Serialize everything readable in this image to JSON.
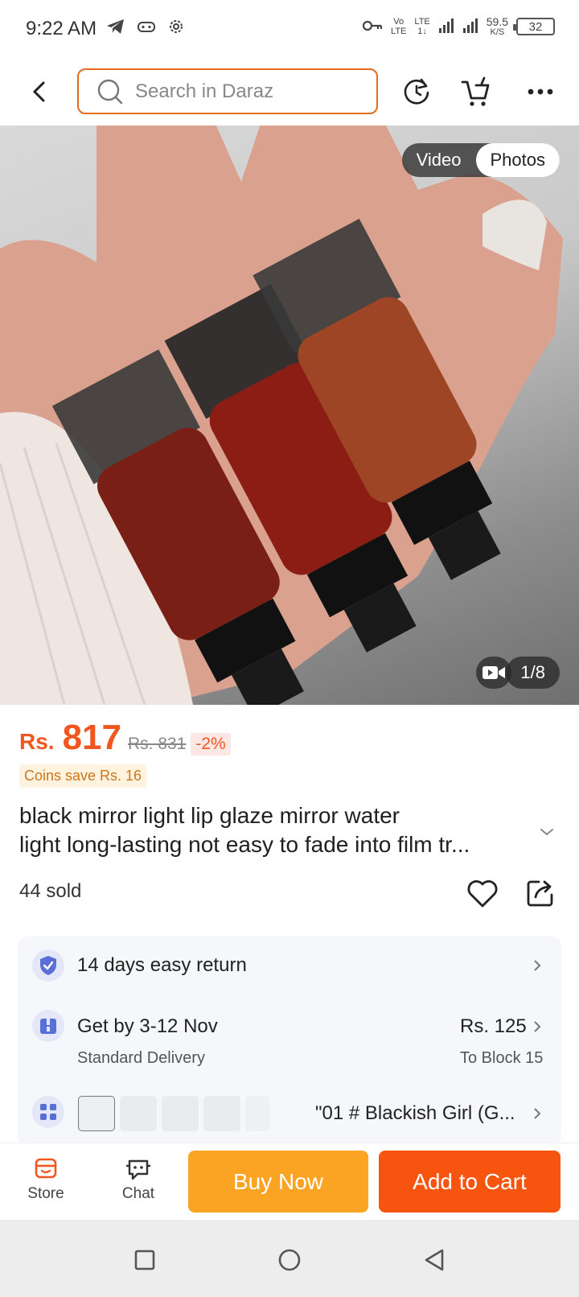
{
  "status_bar": {
    "time": "9:22 AM",
    "lte_top": "Vo",
    "lte_bottom": "LTE",
    "lte2_top": "LTE",
    "lte2_bottom": "1↓",
    "net_speed": "59.5",
    "net_unit": "K/S",
    "battery": "32"
  },
  "header": {
    "search_placeholder": "Search in Daraz"
  },
  "gallery": {
    "tabs": [
      {
        "label": "Video",
        "active": false
      },
      {
        "label": "Photos",
        "active": true
      }
    ],
    "counter": "1/8"
  },
  "price": {
    "currency": "Rs.",
    "value": "817",
    "original": "Rs. 831",
    "discount": "-2%",
    "coins": "Coins save Rs. 16"
  },
  "product": {
    "title_line1": "black mirror light lip glaze mirror water",
    "title_line2": "light long-lasting not easy to fade into film tr...",
    "sold": "44 sold"
  },
  "info": {
    "return": "14 days easy return",
    "delivery": "Get by 3-12 Nov",
    "delivery_type": "Standard Delivery",
    "delivery_fee": "Rs. 125",
    "delivery_to": "To Block 15",
    "variant": "\"01 # Blackish Girl (G...",
    "variant_swatches": [
      "--",
      "--",
      "--",
      "--",
      "--"
    ]
  },
  "bottom_bar": {
    "store": "Store",
    "chat": "Chat",
    "buy_now": "Buy Now",
    "add_to_cart": "Add to Cart"
  },
  "colors": {
    "brand_orange": "#f6540f",
    "buy_yellow": "#fba322",
    "price": "#f0561d"
  }
}
